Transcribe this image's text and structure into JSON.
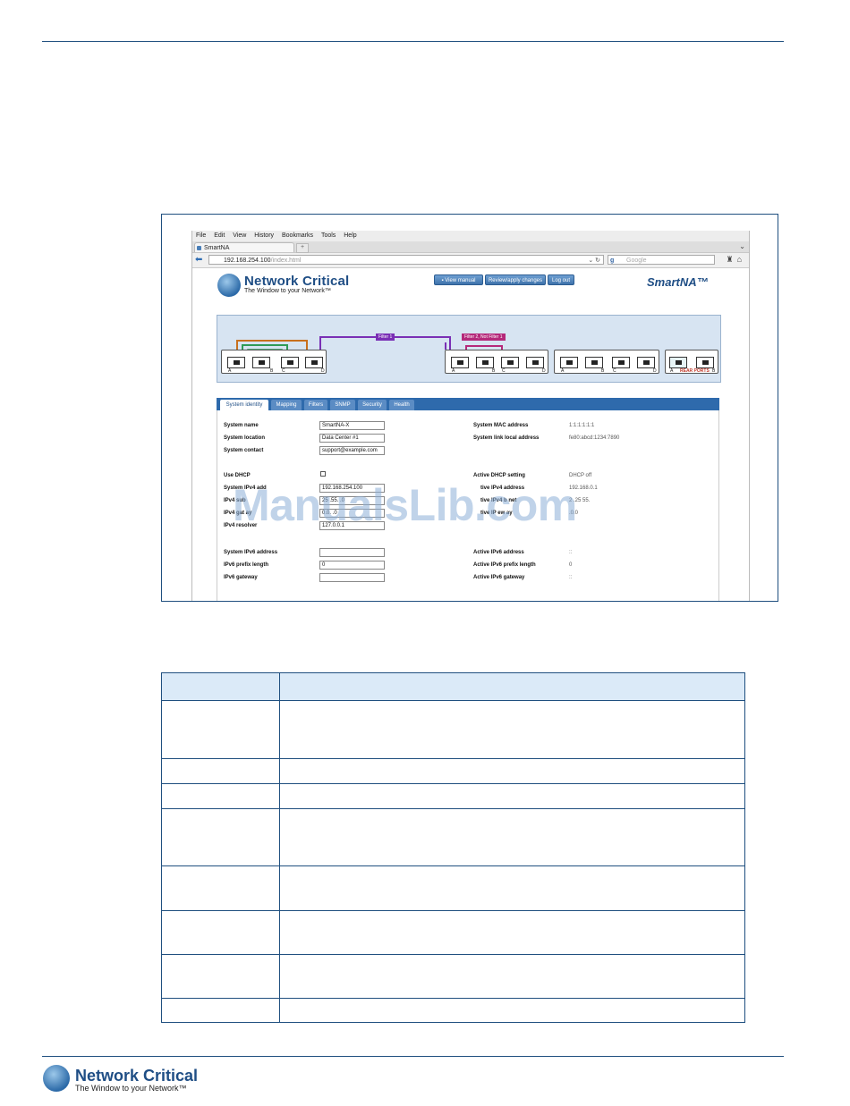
{
  "browser": {
    "menu": [
      "File",
      "Edit",
      "View",
      "History",
      "Bookmarks",
      "Tools",
      "Help"
    ],
    "tab_title": "SmartNA",
    "new_tab": "+",
    "url_main": "192.168.254.100",
    "url_rest": "/index.html",
    "search_engine": "g",
    "search_placeholder": "Google"
  },
  "app": {
    "logo_name": "Network Critical",
    "logo_tagline": "The Window to your Network™",
    "product": "SmartNA™",
    "buttons": [
      "View manual",
      "Review/apply changes",
      "Log out"
    ]
  },
  "topology": {
    "filters": [
      "Filter 1",
      "Filter 2, Not Filter 1"
    ],
    "port_letters": [
      "A",
      "B",
      "C",
      "D"
    ],
    "rear_ports_label": "REAR PORTS",
    "colors": {
      "filter1": "#7a2fb5",
      "filter2": "#b5287a",
      "orange": "#c8701e",
      "green": "#2e9b57"
    }
  },
  "tabs": [
    "System identity",
    "Mapping",
    "Filters",
    "SNMP",
    "Security",
    "Health"
  ],
  "form": {
    "left": [
      {
        "label": "System name",
        "value": "SmartNA-X"
      },
      {
        "label": "System location",
        "value": "Data Center #1"
      },
      {
        "label": "System contact",
        "value": "support@example.com"
      },
      {
        "label": "Use DHCP",
        "value": ""
      },
      {
        "label": "System IPv4 add",
        "value": "192.168.254.100"
      },
      {
        "label": "IPv4 sub",
        "value": "25 .55. .0"
      },
      {
        "label": "IPv4 gat ay",
        "value": "0.0. .0"
      },
      {
        "label": "IPv4 resolver",
        "value": "127.0.0.1"
      },
      {
        "label": "System IPv6 address",
        "value": ""
      },
      {
        "label": "IPv6 prefix length",
        "value": "0"
      },
      {
        "label": "IPv6 gateway",
        "value": ""
      }
    ],
    "right": [
      {
        "label": "System MAC address",
        "value": "1:1:1:1:1:1"
      },
      {
        "label": "System link local address",
        "value": "fe80:abcd:1234:7890"
      },
      {
        "label": "Active DHCP setting",
        "value": "DHCP off"
      },
      {
        "label": "tive IPv4 address",
        "value": "192.168.0.1"
      },
      {
        "label": "tive IPv4 b net",
        "value": "2 .25 55."
      },
      {
        "label": "tive IP ew ay",
        "value": ".0.0"
      },
      {
        "label": "Active IPv6 address",
        "value": "::"
      },
      {
        "label": "Active IPv6 prefix length",
        "value": "0"
      },
      {
        "label": "Active IPv6 gateway",
        "value": "::"
      }
    ]
  },
  "watermark": "ManualsLib.com",
  "footer": {
    "logo_name": "Network Critical",
    "logo_tagline": "The Window to your Network™"
  }
}
